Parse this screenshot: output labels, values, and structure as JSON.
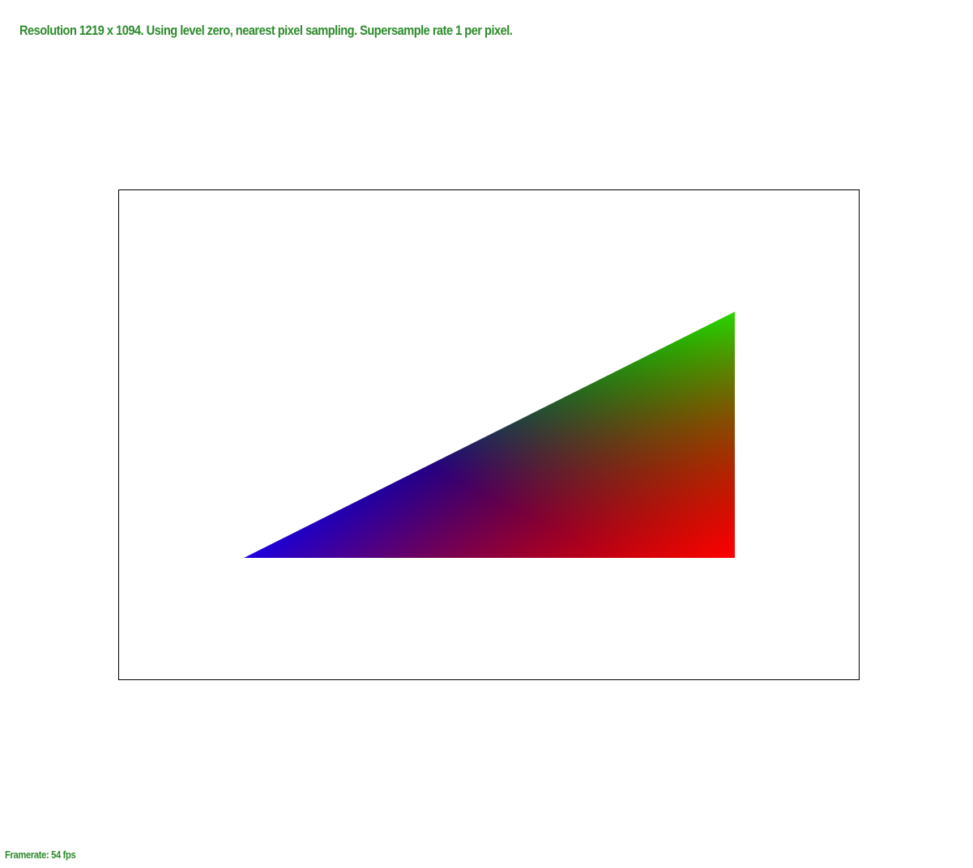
{
  "status": {
    "text": "Resolution 1219 x 1094. Using level zero, nearest pixel sampling. Supersample rate 1 per pixel."
  },
  "footer": {
    "framerate": "Framerate: 54 fps"
  },
  "colors": {
    "text": "#2e8b2e",
    "border": "#000000",
    "background": "#ffffff",
    "vertex_blue": "#0000ff",
    "vertex_green": "#00ff00",
    "vertex_red": "#ff0000"
  }
}
